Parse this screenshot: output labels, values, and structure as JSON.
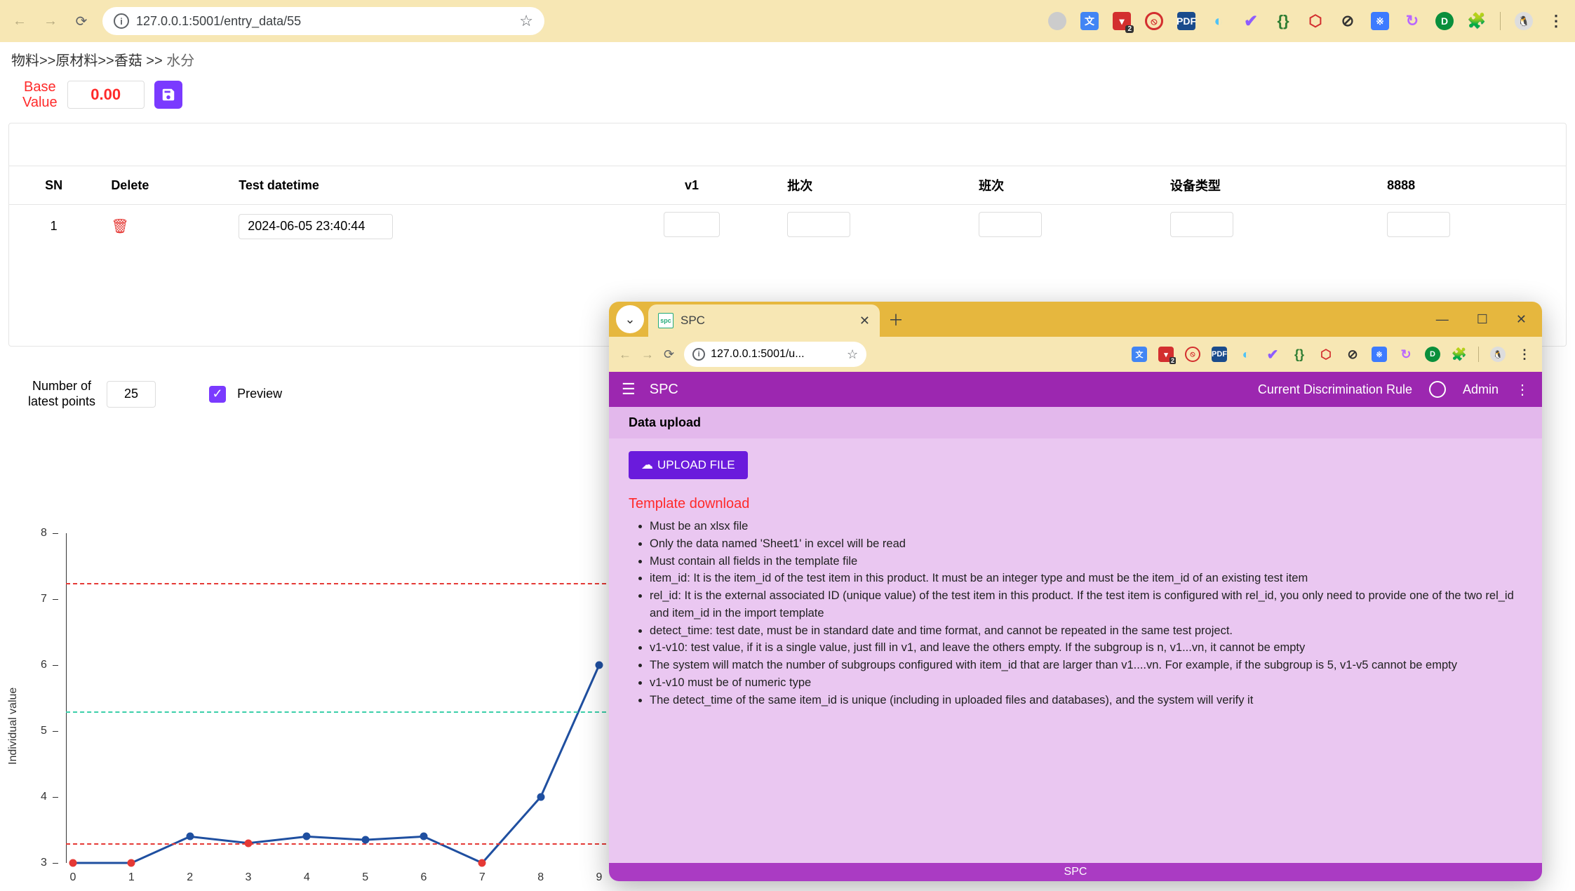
{
  "main_browser": {
    "url": "127.0.0.1:5001/entry_data/55"
  },
  "breadcrumb": {
    "seg1": "物料",
    "seg2": "原材料",
    "seg3": "香菇",
    "seg4": "水分"
  },
  "base_value": {
    "label": "Base\nValue",
    "value": "0.00"
  },
  "table": {
    "headers": {
      "sn": "SN",
      "delete": "Delete",
      "datetime": "Test datetime",
      "v1": "v1",
      "h_batch": "批次",
      "h_shift": "班次",
      "h_device": "设备类型",
      "h_8888": "8888"
    },
    "rows": [
      {
        "sn": "1",
        "datetime": "2024-06-05 23:40:44",
        "v1": "",
        "batch": "",
        "shift": "",
        "device": "",
        "c8888": ""
      }
    ]
  },
  "preview_controls": {
    "num_label": "Number of\nlatest points",
    "num_value": "25",
    "preview_label": "Preview",
    "preview_checked": true
  },
  "chart_data": {
    "type": "line",
    "ylabel": "Individual value",
    "x": [
      0,
      1,
      2,
      3,
      4,
      5,
      6,
      7,
      8,
      9
    ],
    "values": [
      3.0,
      3.0,
      3.4,
      3.3,
      3.4,
      3.35,
      3.4,
      3.0,
      4.0,
      6.0
    ],
    "highlight_red_x": [
      0,
      1,
      3,
      7
    ],
    "ylim": [
      3.0,
      8.0
    ],
    "reference_lines": [
      {
        "name": "ucl",
        "value": 7.25,
        "color": "#e53935"
      },
      {
        "name": "center",
        "value": 5.3,
        "color": "#3bcfa9"
      },
      {
        "name": "lcl",
        "value": 3.3,
        "color": "#e53935"
      }
    ]
  },
  "popup": {
    "tab_title": "SPC",
    "url": "127.0.0.1:5001/u...",
    "appbar": {
      "title": "SPC",
      "rule_label": "Current Discrimination Rule",
      "user": "Admin"
    },
    "panel_title": "Data upload",
    "upload_btn": "UPLOAD FILE",
    "template_link": "Template download",
    "rules": [
      "Must be an xlsx file",
      "Only the data named 'Sheet1' in excel will be read",
      "Must contain all fields in the template file",
      "item_id: It is the item_id of the test item in this product. It must be an integer type and must be the item_id of an existing test item",
      "rel_id: It is the external associated ID (unique value) of the test item in this product. If the test item is configured with rel_id, you only need to provide one of the two rel_id and item_id in the import template",
      "detect_time: test date, must be in standard date and time format, and cannot be repeated in the same test project.",
      "v1-v10: test value, if it is a single value, just fill in v1, and leave the others empty. If the subgroup is n, v1...vn, it cannot be empty",
      "The system will match the number of subgroups configured with item_id that are larger than v1....vn. For example, if the subgroup is 5, v1-v5 cannot be empty",
      "v1-v10 must be of numeric type",
      "The detect_time of the same item_id is unique (including in uploaded files and databases), and the system will verify it"
    ],
    "footer": "SPC"
  }
}
